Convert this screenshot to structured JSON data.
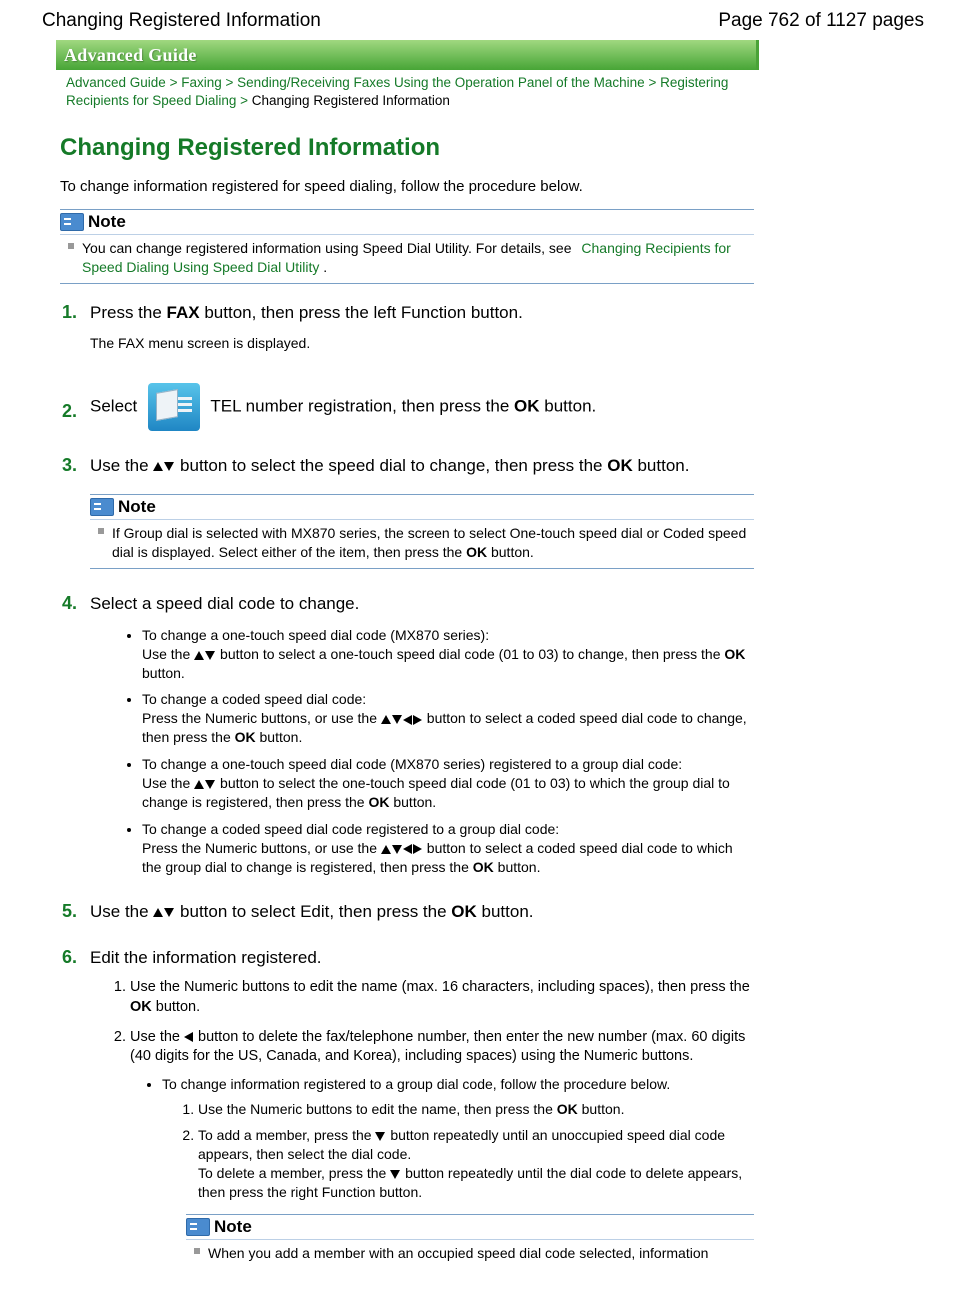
{
  "header": {
    "left": "Changing Registered Information",
    "right": "Page 762 of 1127 pages"
  },
  "banner": "Advanced Guide",
  "breadcrumb": {
    "seg1": "Advanced Guide",
    "seg2": "Faxing",
    "seg3": "Sending/Receiving Faxes Using the Operation Panel of the Machine",
    "seg4": "Registering Recipients for Speed Dialing",
    "current": "Changing Registered Information",
    "sep": " > "
  },
  "title": "Changing Registered Information",
  "intro": "To change information registered for speed dialing, follow the procedure below.",
  "note_label": "Note",
  "note1": {
    "text": "You can change registered information using Speed Dial Utility. For details, see",
    "link": "Changing Recipients for Speed Dialing Using Speed Dial Utility",
    "tail": "."
  },
  "steps": {
    "s1_a": "Press the ",
    "s1_fax": "FAX",
    "s1_b": " button, then press the left Function button.",
    "s1_sub": "The FAX menu screen is displayed.",
    "s2_a": "Select ",
    "s2_b": " TEL number registration, then press the ",
    "s2_c": " button.",
    "ok": "OK",
    "s3_a": "Use the ",
    "s3_b": " button to select the speed dial to change, then press the ",
    "s3_c": " button.",
    "s3_note_a": "If Group dial is selected with MX870 series, the screen to select One-touch speed dial or Coded speed dial is displayed. Select either of the item, then press the ",
    "s3_note_b": " button.",
    "s4": "Select a speed dial code to change.",
    "s4_b1_t": "To change a one-touch speed dial code (MX870 series):",
    "s4_b1_a": "Use the ",
    "s4_b1_b": " button to select a one-touch speed dial code (01 to 03) to change, then press the ",
    "s4_b1_c": " button.",
    "s4_b2_t": "To change a coded speed dial code:",
    "s4_b2_a": "Press the Numeric buttons, or use the ",
    "s4_b2_b": " button to select a coded speed dial code to change, then press the ",
    "s4_b2_c": " button.",
    "s4_b3_t": "To change a one-touch speed dial code (MX870 series) registered to a group dial code:",
    "s4_b3_a": "Use the ",
    "s4_b3_b": " button to select the one-touch speed dial code (01 to 03) to which the group dial to change is registered, then press the ",
    "s4_b3_c": " button.",
    "s4_b4_t": "To change a coded speed dial code registered to a group dial code:",
    "s4_b4_a": "Press the Numeric buttons, or use the ",
    "s4_b4_b": " button to select a coded speed dial code to which the group dial to change is registered, then press the ",
    "s4_b4_c": " button.",
    "s5_a": "Use the ",
    "s5_b": " button to select Edit, then press the ",
    "s5_c": " button.",
    "s6": "Edit the information registered.",
    "s6_1_a": "Use the Numeric buttons to edit the name (max. 16 characters, including spaces), then press the ",
    "s6_1_b": " button.",
    "s6_2_a": "Use the ",
    "s6_2_b": " button to delete the fax/telephone number, then enter the new number (max. 60 digits (40 digits for the US, Canada, and Korea), including spaces) using the Numeric buttons.",
    "s6_2_inner": "To change information registered to a group dial code, follow the procedure below.",
    "s6_2_i1_a": "Use the Numeric buttons to edit the name, then press the ",
    "s6_2_i1_b": " button.",
    "s6_2_i2_a": "To add a member, press the ",
    "s6_2_i2_b": " button repeatedly until an unoccupied speed dial code appears, then select the dial code.",
    "s6_2_i2_c": "To delete a member, press the ",
    "s6_2_i2_d": " button repeatedly until the dial code to delete appears, then press the right Function button.",
    "s6_2_note": "When you add a member with an occupied speed dial code selected, information"
  }
}
